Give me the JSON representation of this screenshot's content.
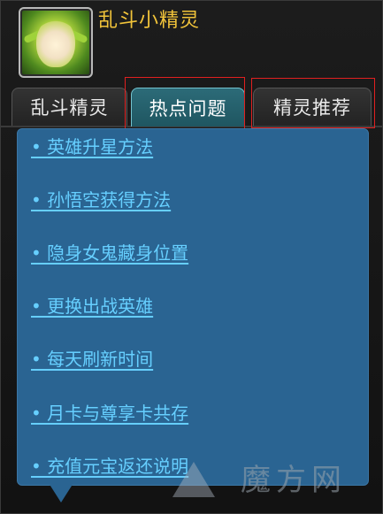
{
  "header": {
    "title": "乱斗小精灵"
  },
  "tabs": [
    {
      "label": "乱斗精灵",
      "active": false
    },
    {
      "label": "热点问题",
      "active": true
    },
    {
      "label": "精灵推荐",
      "active": false
    }
  ],
  "list": {
    "items": [
      "• 英雄升星方法",
      "• 孙悟空获得方法",
      "• 隐身女鬼藏身位置",
      "• 更换出战英雄",
      "• 每天刷新时间",
      "• 月卡与尊享卡共存",
      "• 充值元宝返还说明"
    ]
  },
  "watermark": {
    "text": "魔方网"
  },
  "colors": {
    "title": "#f2c43a",
    "link": "#66cfff",
    "panel": "#2a6492",
    "active_tab": "#2c6b78",
    "highlight_box": "#e02020"
  },
  "icons": {
    "avatar": "elf-avatar-icon"
  }
}
